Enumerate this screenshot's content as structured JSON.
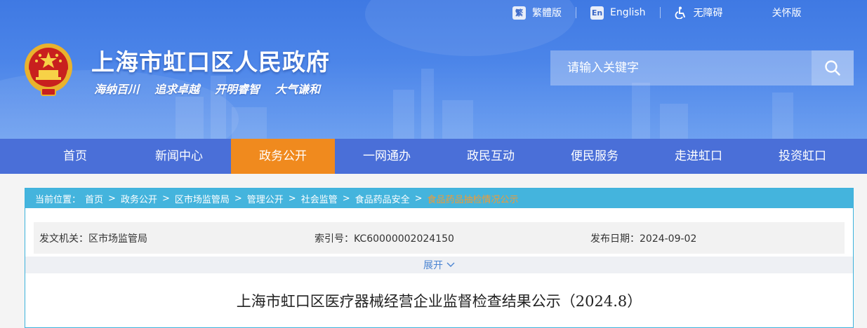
{
  "top_links": {
    "traditional": {
      "badge": "繁",
      "label": "繁體版"
    },
    "english": {
      "badge": "En",
      "label": "English"
    },
    "accessibility": {
      "label": "无障碍"
    },
    "elder": {
      "label": "关怀版"
    }
  },
  "site": {
    "title": "上海市虹口区人民政府",
    "slogans": [
      "海纳百川",
      "追求卓越",
      "开明睿智",
      "大气谦和"
    ]
  },
  "search": {
    "placeholder": "请输入关键字"
  },
  "nav": {
    "items": [
      {
        "label": "首页"
      },
      {
        "label": "新闻中心"
      },
      {
        "label": "政务公开"
      },
      {
        "label": "一网通办"
      },
      {
        "label": "政民互动"
      },
      {
        "label": "便民服务"
      },
      {
        "label": "走进虹口"
      },
      {
        "label": "投资虹口"
      }
    ],
    "active_index": 2
  },
  "breadcrumb": {
    "prefix": "当前位置：",
    "items": [
      "首页",
      "政务公开",
      "区市场监管局",
      "管理公开",
      "社会监管",
      "食品药品安全"
    ],
    "current": "食品药品抽检情况公示",
    "separator": ">"
  },
  "meta": {
    "issuer": "发文机关：区市场监管局",
    "index_no": "索引号：KC60000002024150",
    "date": "发布日期：2024-09-02"
  },
  "expand_label": "展开",
  "article": {
    "title": "上海市虹口区医疗器械经营企业监督检查结果公示（2024.8）"
  },
  "colors": {
    "header_blue": "#4a80e6",
    "nav_blue": "#4a6fd8",
    "nav_active": "#f08a1e",
    "breadcrumb_bar": "#44b4dd",
    "breadcrumb_current": "#f39a32",
    "expand_text": "#4a84d2"
  }
}
